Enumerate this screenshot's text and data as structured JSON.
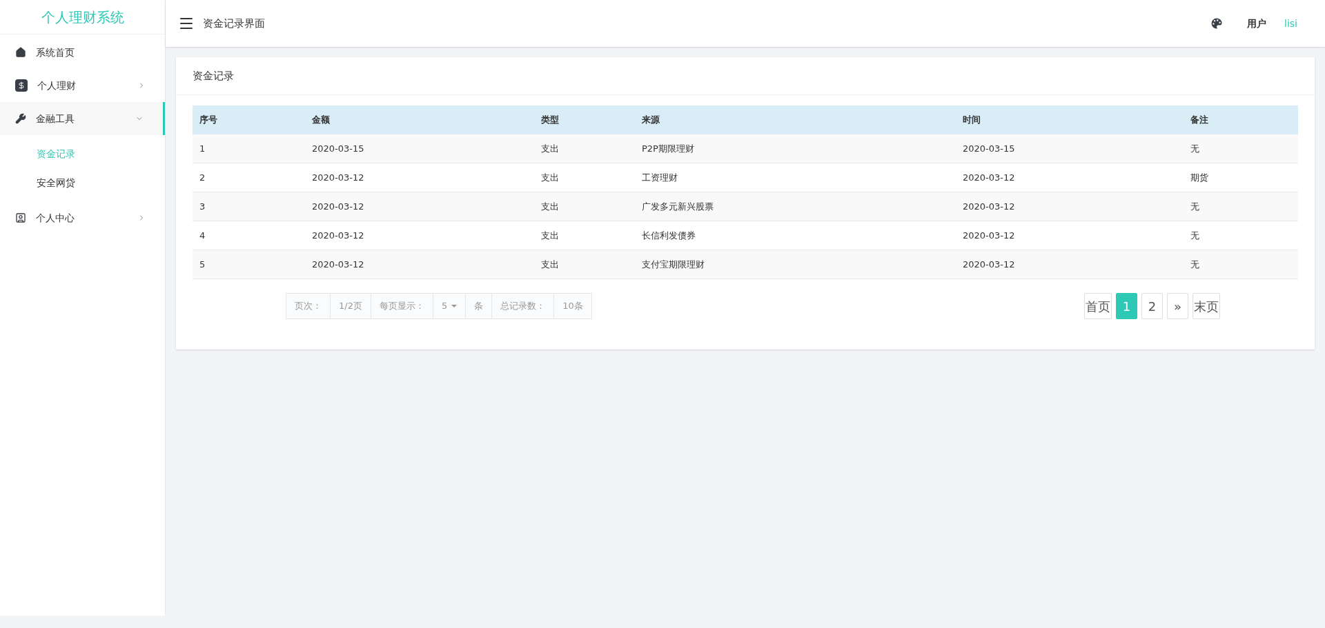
{
  "sidebar": {
    "title": "个人理财系统",
    "items": [
      {
        "kind": "home",
        "label": "系统首页",
        "expandable": false,
        "selected": false
      },
      {
        "kind": "money",
        "label": "个人理财",
        "expandable": true,
        "expanded": false,
        "selected": false
      },
      {
        "kind": "tool",
        "label": "金融工具",
        "expandable": true,
        "expanded": true,
        "selected": true,
        "children": [
          {
            "label": "资金记录",
            "selected": true
          },
          {
            "label": "安全网贷",
            "selected": false
          }
        ]
      },
      {
        "kind": "user",
        "label": "个人中心",
        "expandable": true,
        "expanded": false,
        "selected": false
      }
    ]
  },
  "header": {
    "title": "资金记录界面",
    "user_label": "用户",
    "user_name": "lisi"
  },
  "card": {
    "title": "资金记录"
  },
  "table": {
    "columns": [
      "序号",
      "金额",
      "类型",
      "来源",
      "时间",
      "备注"
    ],
    "rows": [
      [
        "1",
        "2020-03-15",
        "支出",
        "P2P期限理财",
        "2020-03-15",
        "无"
      ],
      [
        "2",
        "2020-03-12",
        "支出",
        "工资理财",
        "2020-03-12",
        "期货"
      ],
      [
        "3",
        "2020-03-12",
        "支出",
        "广发多元新兴股票",
        "2020-03-12",
        "无"
      ],
      [
        "4",
        "2020-03-12",
        "支出",
        "长信利发债券",
        "2020-03-12",
        "无"
      ],
      [
        "5",
        "2020-03-12",
        "支出",
        "支付宝期限理财",
        "2020-03-12",
        "无"
      ]
    ]
  },
  "pager_info": [
    {
      "kind": "text",
      "text": "页次："
    },
    {
      "kind": "text",
      "text": "1/2页"
    },
    {
      "kind": "text",
      "text": "每页显示："
    },
    {
      "kind": "select",
      "text": "5"
    },
    {
      "kind": "text",
      "text": "条"
    },
    {
      "kind": "text",
      "text": "总记录数："
    },
    {
      "kind": "text",
      "text": "10条"
    }
  ],
  "pagination": [
    {
      "label": "首页",
      "selected": false
    },
    {
      "label": "1",
      "selected": true
    },
    {
      "label": "2",
      "selected": false
    },
    {
      "label": "»",
      "selected": false
    },
    {
      "label": "末页",
      "selected": false
    }
  ]
}
